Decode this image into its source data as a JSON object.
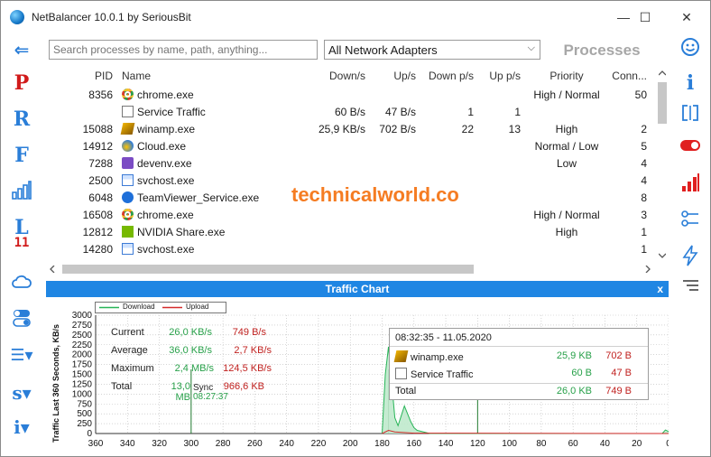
{
  "window": {
    "title": "NetBalancer 10.0.1 by SeriousBit",
    "minimize": "—",
    "maximize": "☐",
    "close": "✕"
  },
  "left_toolbar": {
    "back": "⇐",
    "p": "P",
    "r": "R",
    "f": "F",
    "bars": "📶",
    "l": "L",
    "l_num": "11",
    "cloud": "☁",
    "toggles": "⚙",
    "menu": "☰▾",
    "s": "s▾",
    "i": "i▾"
  },
  "right_toolbar": {
    "smile": "☺",
    "info": "i",
    "brackets": "[]",
    "toggle": "on",
    "signal": "signal",
    "share": "share",
    "bolt": "⚡",
    "menu": "≡"
  },
  "search": {
    "placeholder": "Search processes by name, path, anything..."
  },
  "adapter": {
    "selected": "All Network Adapters"
  },
  "processes_title": "Processes",
  "columns": {
    "pid": "PID",
    "name": "Name",
    "down": "Down/s",
    "up": "Up/s",
    "downp": "Down p/s",
    "upp": "Up p/s",
    "priority": "Priority",
    "conn": "Conn..."
  },
  "rows": [
    {
      "pid": "8356",
      "name": "chrome.exe",
      "icon": "chrome",
      "down": "",
      "up": "",
      "downp": "",
      "upp": "",
      "priority": "High / Normal",
      "conn": "50"
    },
    {
      "pid": "",
      "name": "Service Traffic",
      "icon": "doc",
      "down": "60 B/s",
      "up": "47 B/s",
      "downp": "1",
      "upp": "1",
      "priority": "",
      "conn": ""
    },
    {
      "pid": "15088",
      "name": "winamp.exe",
      "icon": "winamp",
      "down": "25,9 KB/s",
      "up": "702 B/s",
      "downp": "22",
      "upp": "13",
      "priority": "High",
      "conn": "2"
    },
    {
      "pid": "14912",
      "name": "Cloud.exe",
      "icon": "cloud",
      "down": "",
      "up": "",
      "downp": "",
      "upp": "",
      "priority": "Normal / Low",
      "conn": "5"
    },
    {
      "pid": "7288",
      "name": "devenv.exe",
      "icon": "vs",
      "down": "",
      "up": "",
      "downp": "",
      "upp": "",
      "priority": "Low",
      "conn": "4"
    },
    {
      "pid": "2500",
      "name": "svchost.exe",
      "icon": "svc",
      "down": "",
      "up": "",
      "downp": "",
      "upp": "",
      "priority": "",
      "conn": "4"
    },
    {
      "pid": "6048",
      "name": "TeamViewer_Service.exe",
      "icon": "tv",
      "down": "",
      "up": "",
      "downp": "",
      "upp": "",
      "priority": "",
      "conn": "8"
    },
    {
      "pid": "16508",
      "name": "chrome.exe",
      "icon": "chrome",
      "down": "",
      "up": "",
      "downp": "",
      "upp": "",
      "priority": "High / Normal",
      "conn": "3"
    },
    {
      "pid": "12812",
      "name": "NVIDIA Share.exe",
      "icon": "nv",
      "down": "",
      "up": "",
      "downp": "",
      "upp": "",
      "priority": "High",
      "conn": "1"
    },
    {
      "pid": "14280",
      "name": "svchost.exe",
      "icon": "svc",
      "down": "",
      "up": "",
      "downp": "",
      "upp": "",
      "priority": "",
      "conn": "1"
    }
  ],
  "watermark": "technicalworld.co",
  "traffic_chart": {
    "header": "Traffic Chart",
    "close": "x",
    "legend": {
      "download": "Download",
      "upload": "Upload"
    },
    "ylabel": "Traffic Last 360 Seconds, KB/s",
    "stats": {
      "current_label": "Current",
      "current_down": "26,0 KB/s",
      "current_up": "749 B/s",
      "average_label": "Average",
      "average_down": "36,0 KB/s",
      "average_up": "2,7 KB/s",
      "maximum_label": "Maximum",
      "maximum_down": "2,4 MB/s",
      "maximum_up": "124,5 KB/s",
      "total_label": "Total",
      "total_down": "13,0 MB",
      "total_up": "966,6 KB"
    },
    "sync_label": "Sync",
    "sync_time": "08:27:37",
    "tooltip": {
      "timestamp": "08:32:35 - 11.05.2020",
      "rows": [
        {
          "name": "winamp.exe",
          "down": "25,9 KB",
          "up": "702 B"
        },
        {
          "name": "Service Traffic",
          "down": "60 B",
          "up": "47 B"
        }
      ],
      "total_label": "Total",
      "total_down": "26,0 KB",
      "total_up": "749 B"
    },
    "colors": {
      "download": "#27b457",
      "upload": "#d42a2a"
    }
  },
  "chart_data": {
    "type": "area",
    "x_ticks": [
      360,
      340,
      320,
      300,
      280,
      260,
      240,
      220,
      200,
      180,
      160,
      140,
      120,
      100,
      80,
      60,
      40,
      20,
      0
    ],
    "y_ticks": [
      0,
      250,
      500,
      750,
      1000,
      1250,
      1500,
      1750,
      2000,
      2250,
      2500,
      2750,
      3000
    ],
    "xlim": [
      360,
      0
    ],
    "ylim": [
      0,
      3000
    ],
    "ylabel": "Traffic Last 360 Seconds, KB/s",
    "series": [
      {
        "name": "Download",
        "x": [
          180,
          178,
          176,
          174,
          172,
          170,
          166,
          162,
          160,
          158,
          154,
          150,
          4,
          2,
          0
        ],
        "values": [
          0,
          1500,
          2200,
          1300,
          400,
          200,
          700,
          300,
          150,
          80,
          40,
          0,
          0,
          90,
          50
        ]
      },
      {
        "name": "Upload",
        "x": [
          180,
          176,
          172,
          160,
          0
        ],
        "values": [
          0,
          80,
          40,
          10,
          0
        ]
      }
    ],
    "markers": [
      300,
      176,
      120
    ]
  }
}
